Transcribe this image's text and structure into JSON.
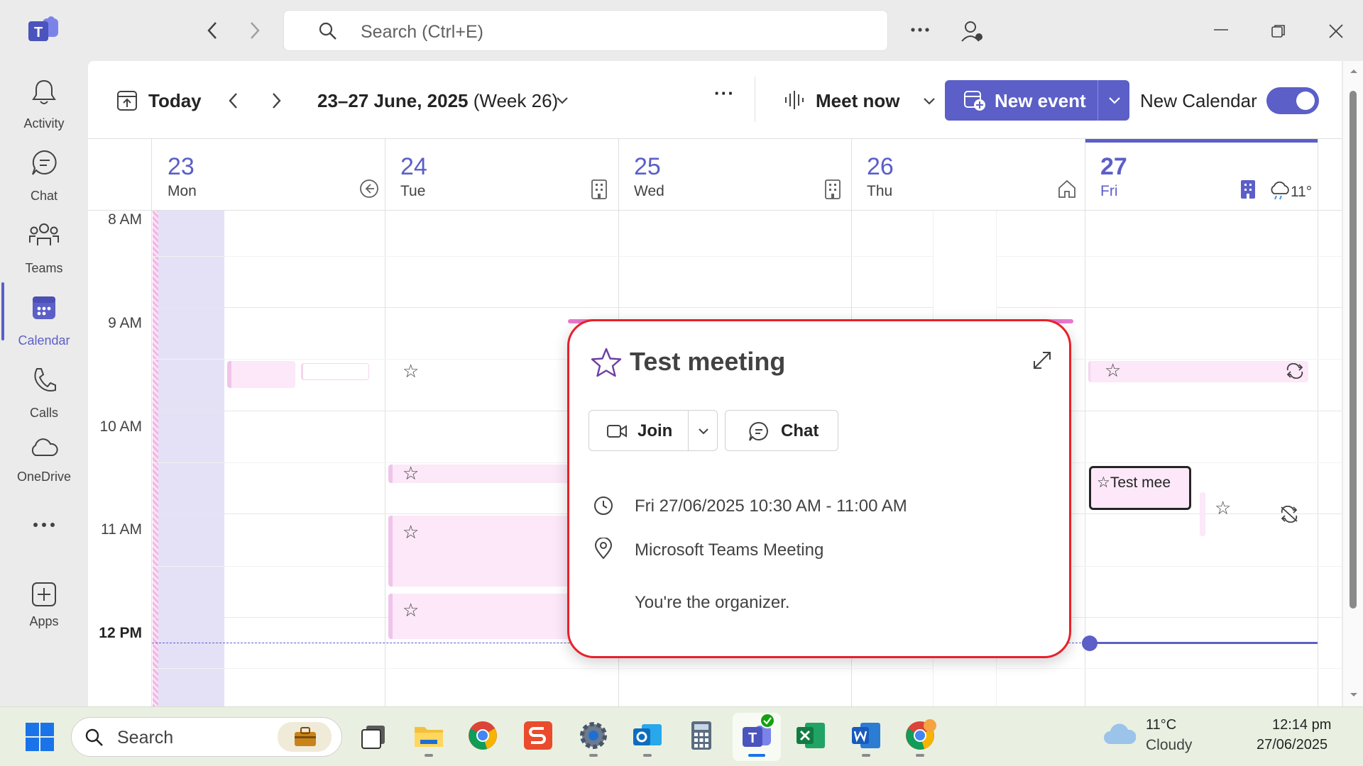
{
  "titlebar": {
    "search_placeholder": "Search (Ctrl+E)"
  },
  "rail": {
    "items": [
      {
        "label": "Activity",
        "icon": "bell-icon"
      },
      {
        "label": "Chat",
        "icon": "chat-icon"
      },
      {
        "label": "Teams",
        "icon": "teams-icon"
      },
      {
        "label": "Calendar",
        "icon": "calendar-icon",
        "active": true
      },
      {
        "label": "Calls",
        "icon": "phone-icon"
      },
      {
        "label": "OneDrive",
        "icon": "cloud-icon"
      },
      {
        "label": "",
        "icon": "more-icon"
      },
      {
        "label": "Apps",
        "icon": "add-apps-icon"
      }
    ]
  },
  "toolbar": {
    "today": "Today",
    "range": "23–27 June, 2025",
    "week": "(Week 26)",
    "more": "···",
    "meet_now": "Meet now",
    "new_event": "New event",
    "new_calendar": "New Calendar",
    "new_calendar_on": true
  },
  "calendar": {
    "days": [
      {
        "num": "23",
        "name": "Mon"
      },
      {
        "num": "24",
        "name": "Tue"
      },
      {
        "num": "25",
        "name": "Wed"
      },
      {
        "num": "26",
        "name": "Thu"
      },
      {
        "num": "27",
        "name": "Fri",
        "today": true
      }
    ],
    "weather": "11°",
    "hours": [
      "8 AM",
      "9 AM",
      "10 AM",
      "11 AM",
      "12 PM"
    ],
    "selected_event_label": "Test mee"
  },
  "popup": {
    "title": "Test meeting",
    "join": "Join",
    "chat": "Chat",
    "time": "Fri 27/06/2025 10:30 AM - 11:00 AM",
    "location": "Microsoft Teams Meeting",
    "organizer": "You're the organizer."
  },
  "taskbar": {
    "search": "Search",
    "weather_temp": "11°C",
    "weather_desc": "Cloudy",
    "time": "12:14 pm",
    "date": "27/06/2025"
  },
  "colors": {
    "accent": "#5b5fc7",
    "event_bg": "#fce8f8",
    "popup_border": "#e8202a"
  }
}
